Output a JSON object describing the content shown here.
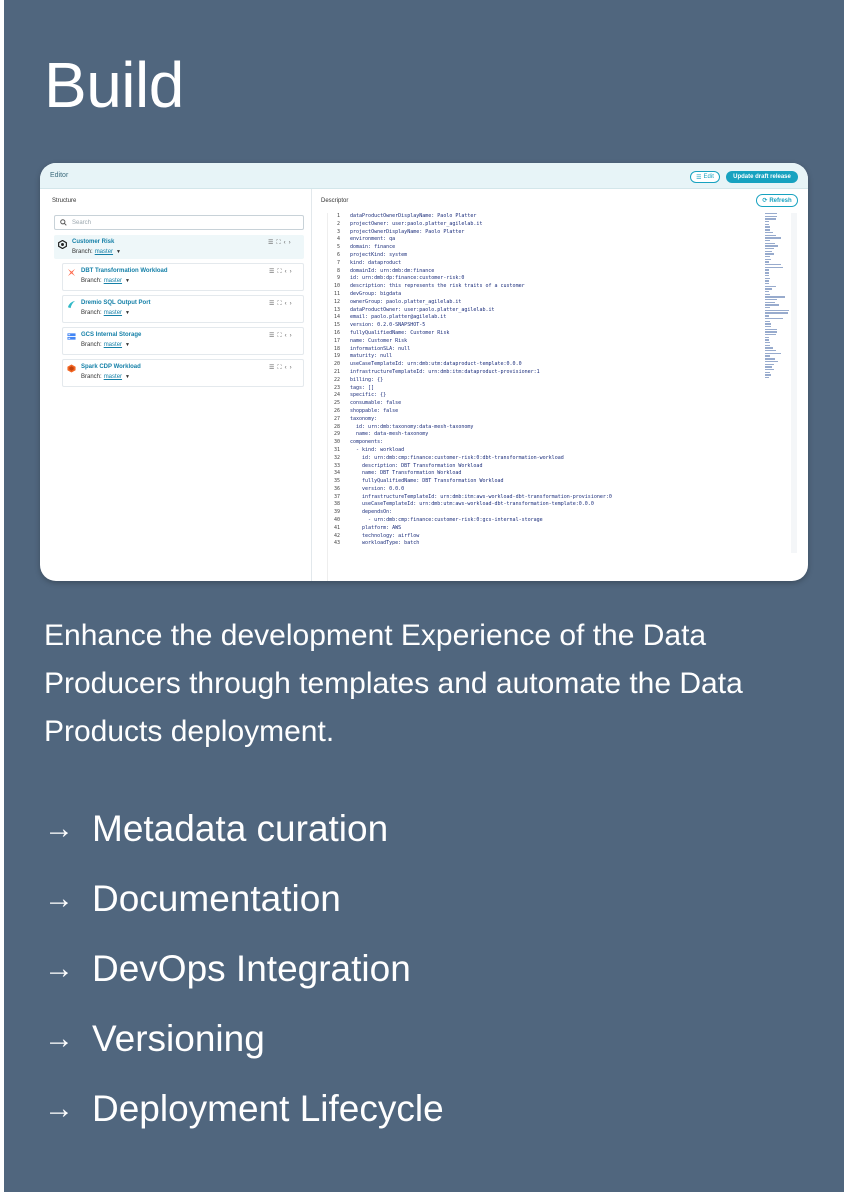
{
  "page": {
    "title": "Build"
  },
  "editor": {
    "header_label": "Editor",
    "edit_button": "Edit",
    "update_button": "Update draft release",
    "structure_label": "Structure",
    "search_placeholder": "Search",
    "root": {
      "name": "Customer Risk",
      "branch_label": "Branch:",
      "branch_value": "master"
    },
    "components": [
      {
        "name": "DBT Transformation Workload",
        "branch_label": "Branch:",
        "branch_value": "master",
        "icon": "dbt-icon",
        "color": "#ff694b"
      },
      {
        "name": "Dremio SQL Output Port",
        "branch_label": "Branch:",
        "branch_value": "master",
        "icon": "dremio-icon",
        "color": "#31b9c7"
      },
      {
        "name": "GCS Internal Storage",
        "branch_label": "Branch:",
        "branch_value": "master",
        "icon": "gcs-icon",
        "color": "#4285f4"
      },
      {
        "name": "Spark CDP Workload",
        "branch_label": "Branch:",
        "branch_value": "master",
        "icon": "cloudera-icon",
        "color": "#f26522"
      }
    ],
    "descriptor_label": "Descriptor",
    "refresh_button": "Refresh",
    "code_lines": [
      "dataProductOwnerDisplayName: Paolo Platter",
      "projectOwner: user:paolo.platter_agilelab.it",
      "projectOwnerDisplayName: Paolo Platter",
      "environment: qa",
      "domain: finance",
      "projectKind: system",
      "kind: dataproduct",
      "domainId: urn:dmb:dm:finance",
      "id: urn:dmb:dp:finance:customer-risk:0",
      "description: this represents the risk traits of a customer",
      "devGroup: bigdata",
      "ownerGroup: paolo.platter_agilelab.it",
      "dataProductOwner: user:paolo.platter_agilelab.it",
      "email: paolo.platter@agilelab.it",
      "version: 0.2.0-SNAPSHOT-5",
      "fullyQualifiedName: Customer Risk",
      "name: Customer Risk",
      "informationSLA: null",
      "maturity: null",
      "useCaseTemplateId: urn:dmb:utm:dataproduct-template:0.0.0",
      "infrastructureTemplateId: urn:dmb:itm:dataproduct-provisioner:1",
      "billing: {}",
      "tags: []",
      "specific: {}",
      "consumable: false",
      "shoppable: false",
      "taxonomy:",
      "  id: urn:dmb:taxonomy:data-mesh-taxonomy",
      "  name: data-mesh-taxonomy",
      "components:",
      "  - kind: workload",
      "    id: urn:dmb:cmp:finance:customer-risk:0:dbt-transformation-workload",
      "    description: DBT Transformation Workload",
      "    name: DBT Transformation Workload",
      "    fullyQualifiedName: DBT Transformation Workload",
      "    version: 0.0.0",
      "    infrastructureTemplateId: urn:dmb:itm:aws-workload-dbt-transformation-provisioner:0",
      "    useCaseTemplateId: urn:dmb:utm:aws-workload-dbt-transformation-template:0.0.0",
      "    dependsOn:",
      "      - urn:dmb:cmp:finance:customer-risk:0:gcs-internal-storage",
      "    platform: AWS",
      "    technology: airflow",
      "    workloadType: batch"
    ]
  },
  "description": "Enhance the development Experience of the Data Producers through templates and automate the Data Products deployment.",
  "features": [
    {
      "arrow": "→",
      "label": "Metadata curation"
    },
    {
      "arrow": "→",
      "label": "Documentation"
    },
    {
      "arrow": "→",
      "label": "DevOps Integration"
    },
    {
      "arrow": "→",
      "label": "Versioning"
    },
    {
      "arrow": "→",
      "label": "Deployment Lifecycle"
    }
  ]
}
